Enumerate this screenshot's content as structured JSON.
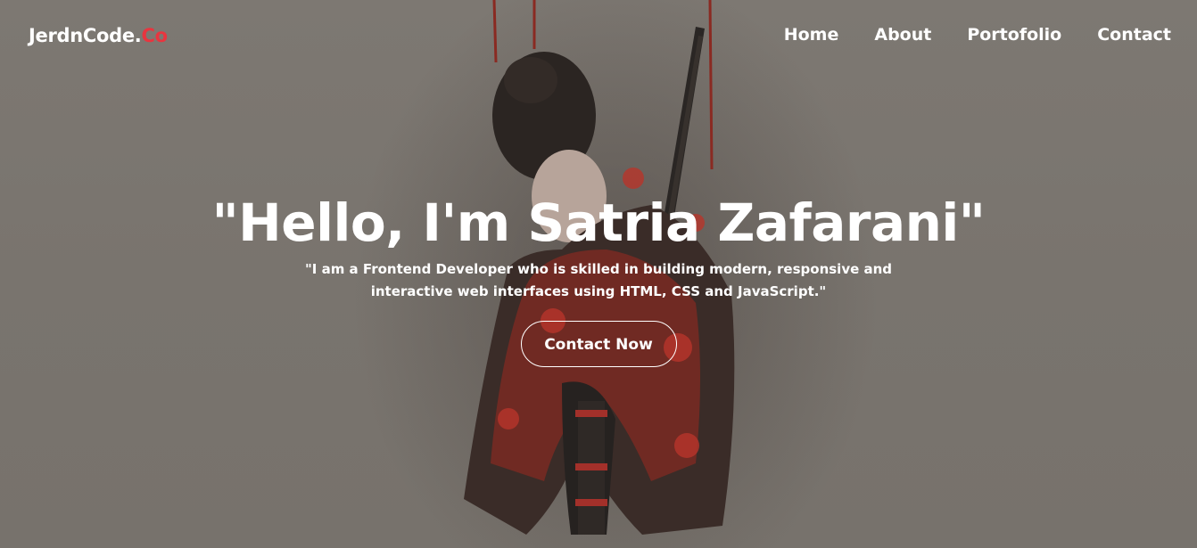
{
  "brand": {
    "name": "JerdnCode.",
    "suffix": "Co",
    "accent_color": "#e8353f"
  },
  "nav": {
    "items": [
      {
        "label": "Home"
      },
      {
        "label": "About"
      },
      {
        "label": "Portofolio"
      },
      {
        "label": "Contact"
      }
    ]
  },
  "hero": {
    "title": "\"Hello, I'm Satria Zafarani\"",
    "subtitle": "\"I am a Frontend Developer who is skilled in building modern, responsive and interactive web interfaces using HTML, CSS and JavaScript.\"",
    "cta_label": "Contact Now",
    "background_image": "samurai-girl-illustration"
  },
  "colors": {
    "background": "#7b7670",
    "text": "#ffffff"
  }
}
